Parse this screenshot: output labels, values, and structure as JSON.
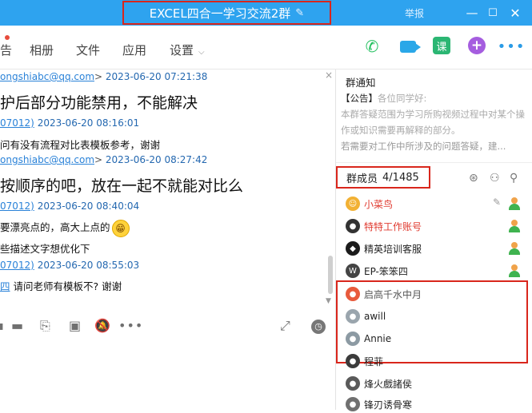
{
  "window": {
    "title": "EXCEL四合一学习交流2群",
    "report_label": "举报",
    "min_glyph": "—",
    "max_glyph": "☐",
    "close_glyph": "✕"
  },
  "toolbar": {
    "tabs": [
      "告",
      "相册",
      "文件",
      "应用",
      "设置"
    ],
    "icons": [
      "phone-icon",
      "video-icon",
      "course-icon",
      "add-icon",
      "more-icon"
    ],
    "course_label": "课",
    "add_glyph": "+",
    "more_glyph": "•••"
  },
  "chat": {
    "messages": [
      {
        "sender": "ongshiabc@qq.com",
        "time": "2023-06-20 07:21:38",
        "text": "护后部分功能禁用，不能解决"
      },
      {
        "sender": "07012)",
        "time": "2023-06-20 08:16:01",
        "text": "问有没有流程对比表模板参考，谢谢"
      },
      {
        "sender": "ongshiabc@qq.com",
        "time": "2023-06-20 08:27:42",
        "text": "按顺序的吧，放在一起不就能对比么"
      },
      {
        "sender": "07012)",
        "time": "2023-06-20 08:40:04",
        "text": "要漂亮点的，高大上点的"
      },
      {
        "sender": "",
        "time": "",
        "text": "些描述文字想优化下"
      },
      {
        "sender": "07012)",
        "time": "2023-06-20 08:55:03",
        "text": "请问老师有模板不?  谢谢",
        "prefix": "四"
      }
    ],
    "emoji_glyph": "😁",
    "meta_separator": ">",
    "close_glyph": "×",
    "scroll_down_glyph": "▼"
  },
  "input_tools": {
    "icons": [
      "folder-icon",
      "file-icon",
      "image-icon",
      "mute-icon",
      "more-icon",
      "expand-icon",
      "history-icon"
    ],
    "glyphs": {
      "folder": "▬",
      "file": "⎘",
      "image": "▣",
      "mute": "🔕",
      "more": "•••",
      "expand": "⤢",
      "history": "◷"
    }
  },
  "notice": {
    "title": "群通知",
    "tag": "【公告】",
    "lead": "各位同学好:",
    "body": "本群答疑范围为学习所购视频过程中对某个操作或知识需要再解释的部分。",
    "more": "若需要对工作中所涉及的问题答疑，建..."
  },
  "members": {
    "label": "群成员",
    "count": "4/1485",
    "header_icons": [
      "search-by-voice-icon",
      "add-member-icon",
      "search-icon"
    ],
    "header_glyphs": [
      "⊛",
      "⚇",
      "⚲"
    ],
    "edit_glyph": "✎",
    "list": [
      {
        "name": "小菜鸟",
        "color": "red",
        "avatar": "#f2b134",
        "admin": true,
        "editable": true
      },
      {
        "name": "特特工作账号",
        "color": "red",
        "avatar": "#333333",
        "admin": true
      },
      {
        "name": "精英培训客服",
        "color": "normal",
        "avatar": "#1b1b1b",
        "admin": true
      },
      {
        "name": "EP-笨笨四",
        "color": "normal",
        "avatar": "#444444",
        "admin": true
      },
      {
        "name": "启高千水中月",
        "color": "faded",
        "avatar": "#e85a3c",
        "admin": false
      },
      {
        "name": "awill",
        "color": "normal",
        "avatar": "#9aa5ad",
        "admin": false
      },
      {
        "name": "Annie",
        "color": "normal",
        "avatar": "#8c9aa3",
        "admin": false
      },
      {
        "name": "程菲",
        "color": "normal",
        "avatar": "#3b3b3b",
        "admin": false
      },
      {
        "name": "烽火戲諸侯",
        "color": "normal",
        "avatar": "#5a5a5a",
        "admin": false
      },
      {
        "name": "锋刃诱骨寒",
        "color": "normal",
        "avatar": "#707070",
        "admin": false
      }
    ]
  }
}
